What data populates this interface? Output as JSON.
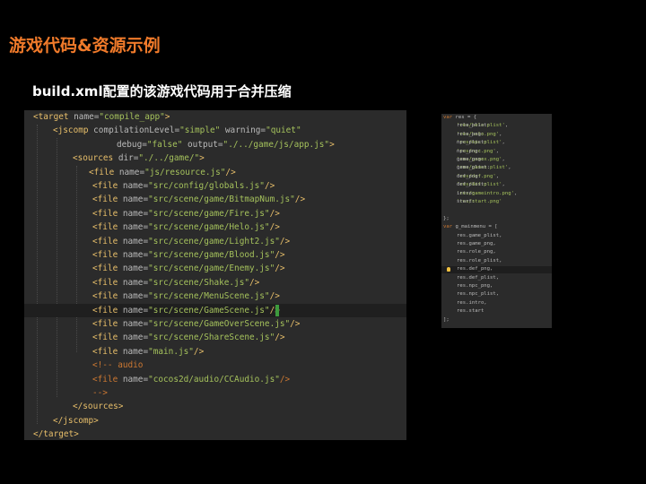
{
  "slide": {
    "title": "游戏代码&资源示例",
    "subtitle": "build.xml配置的该游戏代码用于合并压缩"
  },
  "xml_code": [
    {
      "parts": [
        [
          "tag",
          "<target "
        ],
        [
          "attr",
          "name="
        ],
        [
          "str",
          "\"compile_app\""
        ],
        [
          "tag",
          ">"
        ]
      ]
    },
    {
      "parts": [
        [
          "tag",
          "<jscomp "
        ],
        [
          "attr",
          "compilationLevel="
        ],
        [
          "str",
          "\"simple\""
        ],
        [
          "attr",
          " warning="
        ],
        [
          "str",
          "\"quiet\""
        ]
      ]
    },
    {
      "parts": [
        [
          "attr",
          "debug="
        ],
        [
          "str",
          "\"false\""
        ],
        [
          "attr",
          " output="
        ],
        [
          "str",
          "\"./../game/js/app.js\""
        ],
        [
          "tag",
          ">"
        ]
      ]
    },
    {
      "parts": [
        [
          "tag",
          "<sources "
        ],
        [
          "attr",
          "dir="
        ],
        [
          "str",
          "\"./../game/\""
        ],
        [
          "tag",
          ">"
        ]
      ]
    },
    {
      "parts": [
        [
          "tag",
          "<file "
        ],
        [
          "attr",
          "name="
        ],
        [
          "str",
          "\"js/resource.js\""
        ],
        [
          "tag",
          "/>"
        ]
      ]
    },
    {
      "parts": [
        [
          "tag",
          "<file "
        ],
        [
          "attr",
          "name="
        ],
        [
          "str",
          "\"src/config/globals.js\""
        ],
        [
          "tag",
          "/>"
        ]
      ]
    },
    {
      "parts": [
        [
          "tag",
          "<file "
        ],
        [
          "attr",
          "name="
        ],
        [
          "str",
          "\"src/scene/game/BitmapNum.js\""
        ],
        [
          "tag",
          "/>"
        ]
      ]
    },
    {
      "parts": [
        [
          "tag",
          "<file "
        ],
        [
          "attr",
          "name="
        ],
        [
          "str",
          "\"src/scene/game/Fire.js\""
        ],
        [
          "tag",
          "/>"
        ]
      ]
    },
    {
      "parts": [
        [
          "tag",
          "<file "
        ],
        [
          "attr",
          "name="
        ],
        [
          "str",
          "\"src/scene/game/Helo.js\""
        ],
        [
          "tag",
          "/>"
        ]
      ]
    },
    {
      "parts": [
        [
          "tag",
          "<file "
        ],
        [
          "attr",
          "name="
        ],
        [
          "str",
          "\"src/scene/game/Light2.js\""
        ],
        [
          "tag",
          "/>"
        ]
      ]
    },
    {
      "parts": [
        [
          "tag",
          "<file "
        ],
        [
          "attr",
          "name="
        ],
        [
          "str",
          "\"src/scene/game/Blood.js\""
        ],
        [
          "tag",
          "/>"
        ]
      ]
    },
    {
      "parts": [
        [
          "tag",
          "<file "
        ],
        [
          "attr",
          "name="
        ],
        [
          "str",
          "\"src/scene/game/Enemy.js\""
        ],
        [
          "tag",
          "/>"
        ]
      ]
    },
    {
      "parts": [
        [
          "tag",
          "<file "
        ],
        [
          "attr",
          "name="
        ],
        [
          "str",
          "\"src/scene/Shake.js\""
        ],
        [
          "tag",
          "/>"
        ]
      ]
    },
    {
      "parts": [
        [
          "tag",
          "<file "
        ],
        [
          "attr",
          "name="
        ],
        [
          "str",
          "\"src/scene/MenuScene.js\""
        ],
        [
          "tag",
          "/>"
        ]
      ]
    },
    {
      "parts": [
        [
          "tag",
          "<file "
        ],
        [
          "attr",
          "name="
        ],
        [
          "str",
          "\"src/scene/GameScene.js\""
        ],
        [
          "tag",
          "/>"
        ]
      ]
    },
    {
      "parts": [
        [
          "tag",
          "<file "
        ],
        [
          "attr",
          "name="
        ],
        [
          "str",
          "\"src/scene/GameOverScene.js\""
        ],
        [
          "tag",
          "/>"
        ]
      ]
    },
    {
      "parts": [
        [
          "tag",
          "<file "
        ],
        [
          "attr",
          "name="
        ],
        [
          "str",
          "\"src/scene/ShareScene.js\""
        ],
        [
          "tag",
          "/>"
        ]
      ]
    },
    {
      "parts": [
        [
          "tag",
          "<file "
        ],
        [
          "attr",
          "name="
        ],
        [
          "str",
          "\"main.js\""
        ],
        [
          "tag",
          "/>"
        ]
      ]
    },
    {
      "parts": [
        [
          "cmt",
          "<!-- audio"
        ]
      ]
    },
    {
      "parts": [
        [
          "cmt",
          "<file "
        ],
        [
          "attr",
          "name="
        ],
        [
          "str",
          "\"cocos2d/audio/CCAudio.js\""
        ],
        [
          "cmt",
          "/>"
        ]
      ]
    },
    {
      "parts": [
        [
          "cmt",
          "-->"
        ]
      ]
    },
    {
      "parts": [
        [
          "tag",
          "</sources>"
        ]
      ]
    },
    {
      "parts": [
        [
          "tag",
          "</jscomp>"
        ]
      ]
    },
    {
      "parts": [
        [
          "tag",
          "</target>"
        ]
      ]
    }
  ],
  "js_code": [
    {
      "parts": [
        [
          "kw",
          "var "
        ],
        [
          "txt",
          "res = {"
        ]
      ]
    },
    {
      "parts": [
        [
          "txt",
          "role_plist:"
        ],
        [
          "jstr",
          "'res/helo.plist'"
        ],
        [
          "txt",
          ","
        ]
      ]
    },
    {
      "parts": [
        [
          "txt",
          "role_png:"
        ],
        [
          "jstr",
          "'res/helo.png'"
        ],
        [
          "txt",
          ","
        ]
      ]
    },
    {
      "parts": [
        [
          "txt",
          "npc_plist:"
        ],
        [
          "jstr",
          "'res/npc.plist'"
        ],
        [
          "txt",
          ","
        ]
      ]
    },
    {
      "parts": [
        [
          "txt",
          "npc_png:"
        ],
        [
          "jstr",
          "'res/npc.png'"
        ],
        [
          "txt",
          ","
        ]
      ]
    },
    {
      "parts": [
        [
          "txt",
          "game_png:"
        ],
        [
          "jstr",
          "'res/gamex.png'"
        ],
        [
          "txt",
          ","
        ]
      ]
    },
    {
      "parts": [
        [
          "txt",
          "game_plist:"
        ],
        [
          "jstr",
          "'res/gamex.plist'"
        ],
        [
          "txt",
          ","
        ]
      ]
    },
    {
      "parts": [
        [
          "txt",
          "def_png:"
        ],
        [
          "jstr",
          "'res/def.png'"
        ],
        [
          "txt",
          ","
        ]
      ]
    },
    {
      "parts": [
        [
          "txt",
          "def_plist:"
        ],
        [
          "jstr",
          "'res/def.plist'"
        ],
        [
          "txt",
          ","
        ]
      ]
    },
    {
      "parts": [
        [
          "txt",
          "intro:"
        ],
        [
          "jstr",
          "'res/gameintro.png'"
        ],
        [
          "txt",
          ","
        ]
      ]
    },
    {
      "parts": [
        [
          "txt",
          "start:"
        ],
        [
          "jstr",
          "'res/start.png'"
        ]
      ]
    },
    {
      "parts": [
        [
          "txt",
          ""
        ]
      ]
    },
    {
      "parts": [
        [
          "txt",
          "};"
        ]
      ]
    },
    {
      "parts": [
        [
          "kw",
          "var "
        ],
        [
          "txt",
          "g_mainmenu = ["
        ]
      ]
    },
    {
      "parts": [
        [
          "txt",
          "res.game_plist,"
        ]
      ]
    },
    {
      "parts": [
        [
          "txt",
          "res.game_png,"
        ]
      ]
    },
    {
      "parts": [
        [
          "txt",
          "res.role_png,"
        ]
      ]
    },
    {
      "parts": [
        [
          "txt",
          "res.role_plist,"
        ]
      ]
    },
    {
      "parts": [
        [
          "txt",
          "res.def_png,"
        ]
      ]
    },
    {
      "parts": [
        [
          "txt",
          "res.def_plist,"
        ]
      ]
    },
    {
      "parts": [
        [
          "txt",
          "res.npc_png,"
        ]
      ]
    },
    {
      "parts": [
        [
          "txt",
          "res.npc_plist,"
        ]
      ]
    },
    {
      "parts": [
        [
          "txt",
          "res.intro,"
        ]
      ]
    },
    {
      "parts": [
        [
          "txt",
          "res.start"
        ]
      ]
    },
    {
      "parts": [
        [
          "txt",
          "];"
        ]
      ]
    }
  ]
}
